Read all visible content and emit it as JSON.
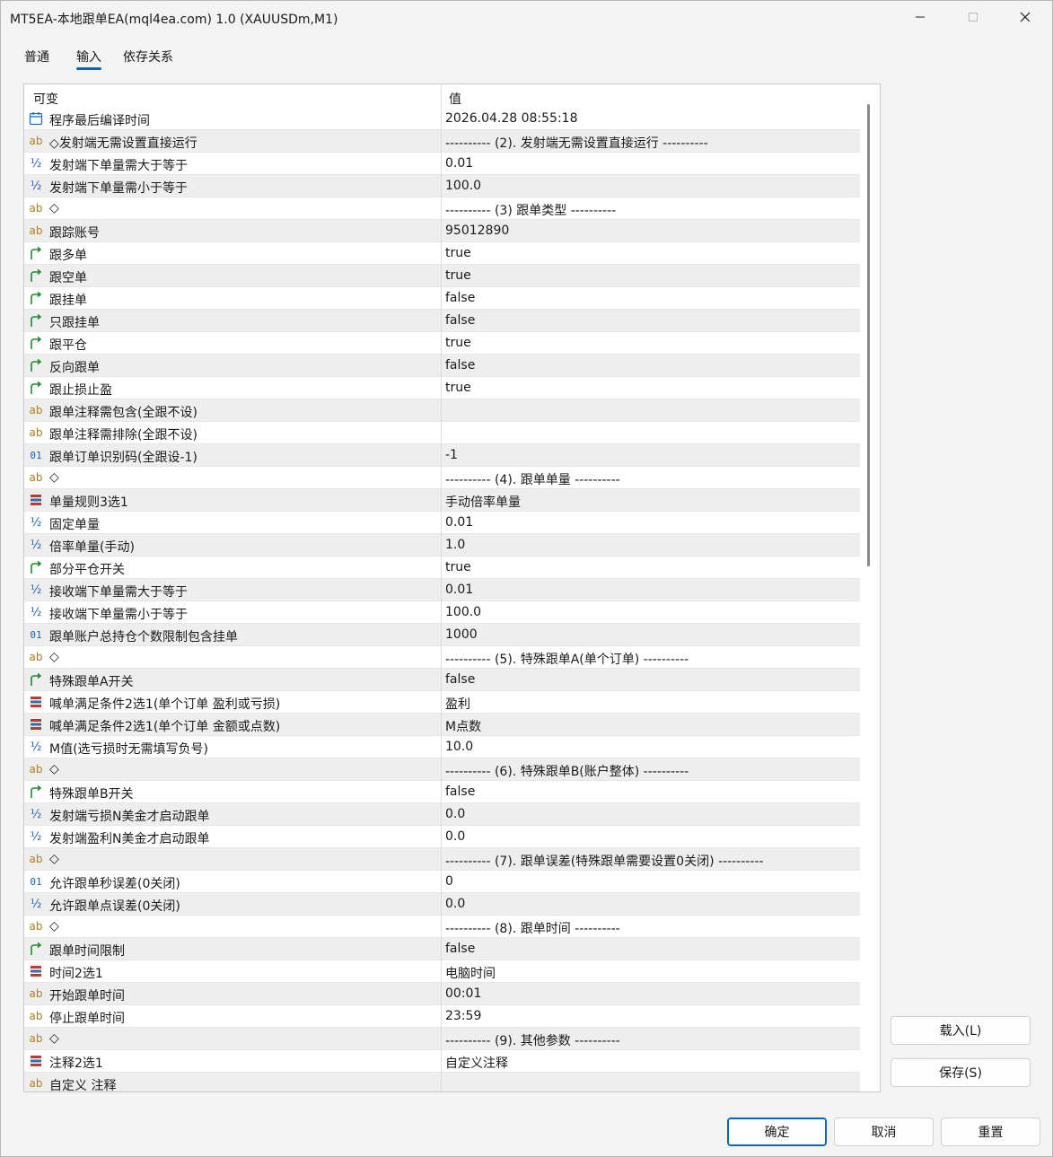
{
  "window": {
    "title": "MT5EA-本地跟单EA(mql4ea.com) 1.0 (XAUUSDm,M1)",
    "controls": {
      "minimize": "—",
      "maximize": "☐",
      "close": "✕"
    }
  },
  "tabs": [
    {
      "label": "普通"
    },
    {
      "label": "输入"
    },
    {
      "label": "依存关系"
    }
  ],
  "table": {
    "columns": {
      "variable": "可变",
      "value": "值"
    },
    "rows": [
      {
        "icon": "calendar-icon",
        "name": "程序最后编译时间",
        "value": "2026.04.28 08:55:18"
      },
      {
        "icon": "string-icon",
        "name": "◇发射端无需设置直接运行",
        "value": "---------- (2). 发射端无需设置直接运行 ----------"
      },
      {
        "icon": "double-icon",
        "name": "发射端下单量需大于等于",
        "value": "0.01"
      },
      {
        "icon": "double-icon",
        "name": "发射端下单量需小于等于",
        "value": "100.0"
      },
      {
        "icon": "string-icon",
        "name": "◇",
        "value": "---------- (3) 跟单类型 ----------"
      },
      {
        "icon": "string-icon",
        "name": "跟踪账号",
        "value": "95012890"
      },
      {
        "icon": "bool-icon",
        "name": "跟多单",
        "value": "true"
      },
      {
        "icon": "bool-icon",
        "name": "跟空单",
        "value": "true"
      },
      {
        "icon": "bool-icon",
        "name": "跟挂单",
        "value": "false"
      },
      {
        "icon": "bool-icon",
        "name": "只跟挂单",
        "value": "false"
      },
      {
        "icon": "bool-icon",
        "name": "跟平仓",
        "value": "true"
      },
      {
        "icon": "bool-icon",
        "name": "反向跟单",
        "value": "false"
      },
      {
        "icon": "bool-icon",
        "name": "跟止损止盈",
        "value": "true"
      },
      {
        "icon": "string-icon",
        "name": "跟单注释需包含(全跟不设)",
        "value": ""
      },
      {
        "icon": "string-icon",
        "name": "跟单注释需排除(全跟不设)",
        "value": ""
      },
      {
        "icon": "int-icon",
        "name": "跟单订单识别码(全跟设-1)",
        "value": "-1"
      },
      {
        "icon": "string-icon",
        "name": "◇",
        "value": "---------- (4). 跟单单量 ----------"
      },
      {
        "icon": "enum-icon",
        "name": "单量规则3选1",
        "value": "手动倍率单量"
      },
      {
        "icon": "double-icon",
        "name": "固定单量",
        "value": "0.01"
      },
      {
        "icon": "double-icon",
        "name": "倍率单量(手动)",
        "value": "1.0"
      },
      {
        "icon": "bool-icon",
        "name": "部分平仓开关",
        "value": "true"
      },
      {
        "icon": "double-icon",
        "name": "接收端下单量需大于等于",
        "value": "0.01"
      },
      {
        "icon": "double-icon",
        "name": "接收端下单量需小于等于",
        "value": "100.0"
      },
      {
        "icon": "int-icon",
        "name": "跟单账户总持仓个数限制包含挂单",
        "value": "1000"
      },
      {
        "icon": "string-icon",
        "name": "◇",
        "value": "---------- (5). 特殊跟单A(单个订单) ----------"
      },
      {
        "icon": "bool-icon",
        "name": "特殊跟单A开关",
        "value": "false"
      },
      {
        "icon": "enum-icon",
        "name": "喊单满足条件2选1(单个订单 盈利或亏损)",
        "value": "盈利"
      },
      {
        "icon": "enum-icon",
        "name": "喊单满足条件2选1(单个订单 金额或点数)",
        "value": "M点数"
      },
      {
        "icon": "double-icon",
        "name": "M值(选亏损时无需填写负号)",
        "value": "10.0"
      },
      {
        "icon": "string-icon",
        "name": "◇",
        "value": "---------- (6). 特殊跟单B(账户整体) ----------"
      },
      {
        "icon": "bool-icon",
        "name": "特殊跟单B开关",
        "value": "false"
      },
      {
        "icon": "double-icon",
        "name": "发射端亏损N美金才启动跟单",
        "value": "0.0"
      },
      {
        "icon": "double-icon",
        "name": "发射端盈利N美金才启动跟单",
        "value": "0.0"
      },
      {
        "icon": "string-icon",
        "name": "◇",
        "value": "---------- (7). 跟单误差(特殊跟单需要设置0关闭) ----------"
      },
      {
        "icon": "int-icon",
        "name": "允许跟单秒误差(0关闭)",
        "value": "0"
      },
      {
        "icon": "double-icon",
        "name": "允许跟单点误差(0关闭)",
        "value": "0.0"
      },
      {
        "icon": "string-icon",
        "name": "◇",
        "value": "---------- (8). 跟单时间 ----------"
      },
      {
        "icon": "bool-icon",
        "name": "跟单时间限制",
        "value": "false"
      },
      {
        "icon": "enum-icon",
        "name": "时间2选1",
        "value": "电脑时间"
      },
      {
        "icon": "string-icon",
        "name": "开始跟单时间",
        "value": "00:01"
      },
      {
        "icon": "string-icon",
        "name": "停止跟单时间",
        "value": "23:59"
      },
      {
        "icon": "string-icon",
        "name": "◇",
        "value": "---------- (9). 其他参数 ----------"
      },
      {
        "icon": "enum-icon",
        "name": "注释2选1",
        "value": "自定义注释"
      },
      {
        "icon": "string-icon",
        "name": "自定义 注释",
        "value": ""
      }
    ]
  },
  "side_buttons": {
    "load": "载入(L)",
    "save": "保存(S)"
  },
  "footer_buttons": {
    "ok": "确定",
    "cancel": "取消",
    "reset": "重置"
  },
  "colors": {
    "accent": "#0067c0",
    "row_alt": "#eeeeee",
    "bool_icon": "#1f8a2e",
    "string_icon": "#b07d1a"
  }
}
